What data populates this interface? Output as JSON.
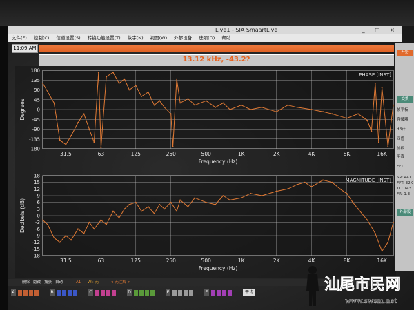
{
  "window": {
    "title": "Live1 - SIA SmaartLive",
    "controls": "_ □ ×"
  },
  "menu": [
    "文件(F)",
    "控制(C)",
    "信道设置(S)",
    "转换功能设置(T)",
    "数字(N)",
    "视图(W)",
    "外部设备",
    "选项(O)",
    "帮助"
  ],
  "clock": "11:09 AM",
  "readout": "13.12 kHz, -43.2?",
  "phase_plot": {
    "tag": "PHASE [INST]",
    "ylabel": "Degrees",
    "xlabel": "Frequency (Hz)",
    "y_ticks": [
      "180",
      "135",
      "90",
      "45",
      "0",
      "-45",
      "-90",
      "-135",
      "-180"
    ],
    "x_ticks": [
      "31.5",
      "63",
      "125",
      "250",
      "500",
      "1K",
      "2K",
      "4K",
      "8K",
      "16K"
    ]
  },
  "magnitude_plot": {
    "tag": "MAGNITUDE [INST]",
    "ylabel": "Decibels (dB)",
    "xlabel": "Frequency (Hz)",
    "y_ticks": [
      "18",
      "15",
      "12",
      "9",
      "6",
      "3",
      "0",
      "-3",
      "-6",
      "-9",
      "-12",
      "-15",
      "-18"
    ],
    "x_ticks": [
      "31.5",
      "63",
      "125",
      "250",
      "500",
      "1K",
      "2K",
      "4K",
      "8K",
      "16K"
    ]
  },
  "chart_data": [
    {
      "type": "line",
      "title": "PHASE [INST]",
      "xlabel": "Frequency (Hz)",
      "ylabel": "Degrees",
      "x_scale": "log",
      "xlim": [
        20,
        20000
      ],
      "ylim": [
        -180,
        180
      ],
      "grid": true,
      "series": [
        {
          "color": "#e07a35",
          "x": [
            20,
            25,
            28,
            31.5,
            35,
            40,
            45,
            50,
            55,
            60,
            63,
            70,
            80,
            90,
            100,
            110,
            125,
            140,
            160,
            180,
            200,
            220,
            250,
            260,
            280,
            300,
            350,
            400,
            500,
            600,
            700,
            800,
            1000,
            1200,
            1500,
            2000,
            2500,
            3000,
            4000,
            5000,
            6000,
            8000,
            10000,
            12000,
            13000,
            14000,
            15000,
            16000,
            18000,
            20000
          ],
          "y": [
            120,
            30,
            -140,
            -160,
            -120,
            -60,
            -20,
            -90,
            -150,
            170,
            -175,
            150,
            170,
            120,
            140,
            90,
            110,
            60,
            80,
            20,
            40,
            10,
            -20,
            -170,
            140,
            30,
            50,
            20,
            40,
            10,
            30,
            0,
            20,
            0,
            10,
            -10,
            20,
            10,
            0,
            -10,
            -20,
            -40,
            -20,
            -50,
            -100,
            120,
            -150,
            100,
            -170,
            20
          ]
        }
      ]
    },
    {
      "type": "line",
      "title": "MAGNITUDE [INST]",
      "xlabel": "Frequency (Hz)",
      "ylabel": "Decibels (dB)",
      "x_scale": "log",
      "xlim": [
        20,
        20000
      ],
      "ylim": [
        -18,
        18
      ],
      "grid": true,
      "series": [
        {
          "color": "#e07a35",
          "x": [
            20,
            22,
            25,
            28,
            31.5,
            35,
            40,
            45,
            50,
            55,
            63,
            70,
            80,
            90,
            100,
            110,
            125,
            140,
            160,
            180,
            200,
            220,
            250,
            280,
            300,
            350,
            400,
            500,
            600,
            700,
            800,
            1000,
            1200,
            1500,
            2000,
            2500,
            3000,
            3500,
            4000,
            5000,
            6000,
            7000,
            8000,
            9000,
            10000,
            12000,
            14000,
            16000,
            18000,
            20000
          ],
          "y": [
            -2,
            -4,
            -10,
            -12,
            -9,
            -11,
            -6,
            -8,
            -3,
            -6,
            -2,
            -4,
            2,
            -1,
            3,
            5,
            6,
            2,
            4,
            1,
            5,
            3,
            6,
            2,
            7,
            4,
            8,
            6,
            5,
            9,
            7,
            8,
            10,
            9,
            11,
            12,
            14,
            15,
            13,
            16,
            15,
            12,
            10,
            6,
            3,
            -2,
            -8,
            -16,
            -12,
            -3
          ]
        }
      ]
    }
  ],
  "sidebar": {
    "buttons": [
      "开始",
      "交换",
      "帧平板",
      "存储器",
      "dB计",
      "阀值",
      "加权",
      "平直",
      "FFT"
    ],
    "info": [
      "SR: 441",
      "FFT: 32K",
      "TC: 743",
      "FR: 1.3"
    ],
    "bottom_button": "外部设"
  },
  "bottom_bar": {
    "items": [
      "删除",
      "隐藏",
      "捕获",
      "自动"
    ],
    "channel": "A1",
    "wi_label": "Wi: 无",
    "note": "< 无注解 >"
  },
  "swatch_groups": [
    {
      "letter": "A",
      "colors": [
        "#c25f33",
        "#c25f33",
        "#c25f33",
        "#c25f33"
      ]
    },
    {
      "letter": "B",
      "colors": [
        "#3b57c6",
        "#3b57c6",
        "#3b57c6",
        "#3b57c6"
      ]
    },
    {
      "letter": "C",
      "colors": [
        "#c24090",
        "#c24090",
        "#c24090",
        "#c24090"
      ]
    },
    {
      "letter": "D",
      "colors": [
        "#5a9a3a",
        "#5a9a3a",
        "#5a9a3a",
        "#5a9a3a"
      ]
    },
    {
      "letter": "E",
      "colors": [
        "#9a9a9a",
        "#9a9a9a",
        "#9a9a9a",
        "#9a9a9a"
      ]
    },
    {
      "letter": "F",
      "colors": [
        "#a23fb5",
        "#a23fb5",
        "#a23fb5",
        "#a23fb5"
      ]
    }
  ],
  "average_button": "平均",
  "watermark": {
    "text": "汕尾市民网",
    "url": "www.swsm.net"
  }
}
